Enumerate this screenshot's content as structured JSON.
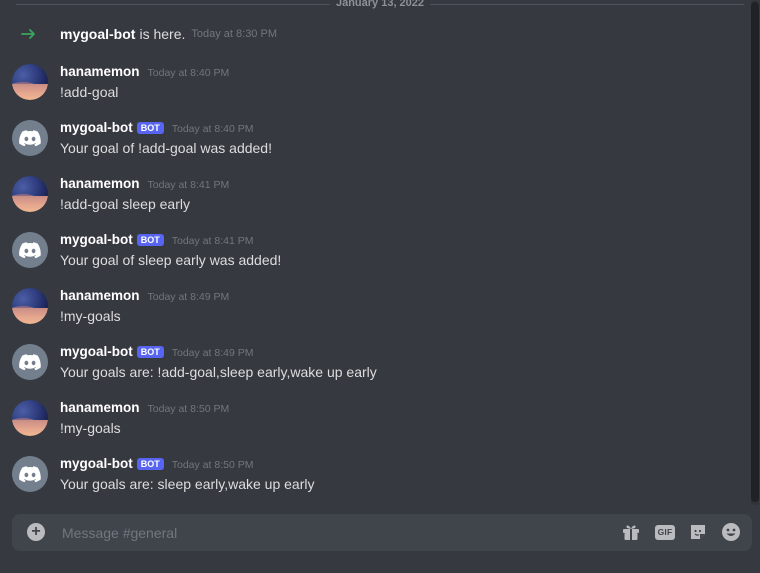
{
  "channel": {
    "date_divider": "January 13, 2022",
    "join": {
      "username": "mygoal-bot",
      "text": "is here.",
      "timestamp": "Today at 8:30 PM"
    },
    "messages": [
      {
        "author": "hanamemon",
        "bot": false,
        "timestamp": "Today at 8:40 PM",
        "text": "!add-goal"
      },
      {
        "author": "mygoal-bot",
        "bot": true,
        "badge": "BOT",
        "timestamp": "Today at 8:40 PM",
        "text": "Your goal of !add-goal was added!"
      },
      {
        "author": "hanamemon",
        "bot": false,
        "timestamp": "Today at 8:41 PM",
        "text": "!add-goal sleep early"
      },
      {
        "author": "mygoal-bot",
        "bot": true,
        "badge": "BOT",
        "timestamp": "Today at 8:41 PM",
        "text": "Your goal of sleep early was added!"
      },
      {
        "author": "hanamemon",
        "bot": false,
        "timestamp": "Today at 8:49 PM",
        "text": "!my-goals"
      },
      {
        "author": "mygoal-bot",
        "bot": true,
        "badge": "BOT",
        "timestamp": "Today at 8:49 PM",
        "text": "Your goals are: !add-goal,sleep early,wake up early"
      },
      {
        "author": "hanamemon",
        "bot": false,
        "timestamp": "Today at 8:50 PM",
        "text": "!my-goals"
      },
      {
        "author": "mygoal-bot",
        "bot": true,
        "badge": "BOT",
        "timestamp": "Today at 8:50 PM",
        "text": "Your goals are: sleep early,wake up early"
      }
    ]
  },
  "composer": {
    "placeholder": "Message #general",
    "value": "",
    "tools": {
      "gift": "gift-icon",
      "gif_label": "GIF",
      "sticker": "sticker-icon",
      "emoji": "emoji-icon",
      "attach": "plus-circle-icon"
    }
  },
  "colors": {
    "background": "#36393f",
    "composer_bg": "#40444b",
    "bot_badge": "#5865f2",
    "join_arrow": "#3ba55d",
    "timestamp": "#72767d"
  }
}
